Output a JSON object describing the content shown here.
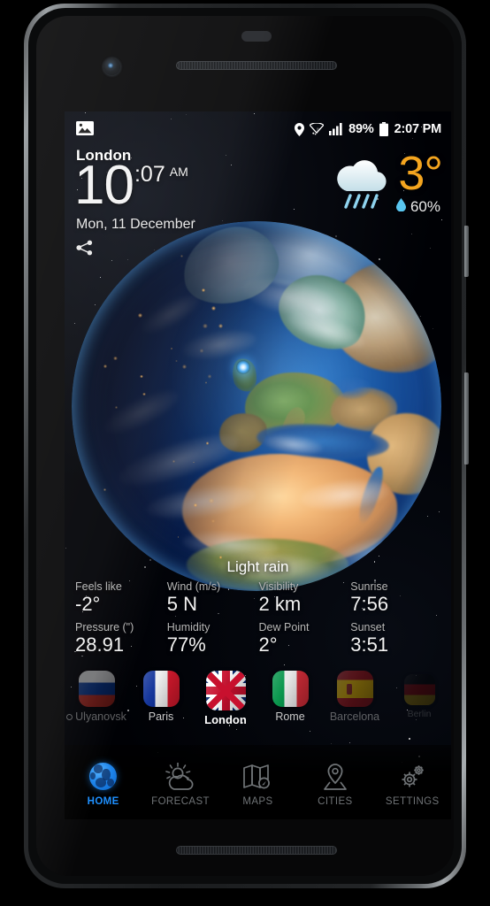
{
  "status_bar": {
    "location_icon": "location-pin-icon",
    "wifi_icon": "wifi-icon",
    "signal_icon": "cellular-signal-icon",
    "battery_percent": "89%",
    "battery_icon": "battery-icon",
    "clock": "2:07 PM"
  },
  "header": {
    "photo_icon": "image-icon",
    "city": "London",
    "time_hour": "10",
    "time_minute": ":07",
    "time_ampm": "AM",
    "date": "Mon, 11 December",
    "share_icon": "share-icon"
  },
  "current_weather": {
    "icon": "rain-cloud-icon",
    "temperature": "3",
    "degree": "°",
    "precip_icon": "water-drop-icon",
    "precip_chance": "60%",
    "condition": "Light rain",
    "temp_color": "#f4a51f",
    "accent_color": "#1e90ff"
  },
  "details": [
    {
      "label": "Feels like",
      "value": "-2°"
    },
    {
      "label": "Wind (m/s)",
      "value": "5 N"
    },
    {
      "label": "Visibility",
      "value": "2 km"
    },
    {
      "label": "Sunrise",
      "value": "7:56"
    },
    {
      "label": "Pressure (\")",
      "value": "28.91"
    },
    {
      "label": "Humidity",
      "value": "77%"
    },
    {
      "label": "Dew Point",
      "value": "2°"
    },
    {
      "label": "Sunset",
      "value": "3:51"
    }
  ],
  "cities": [
    {
      "label": "Ulyanovsk",
      "flag": "ru",
      "current_location": true
    },
    {
      "label": "Paris",
      "flag": "fr",
      "current_location": false
    },
    {
      "label": "London",
      "flag": "gb",
      "current_location": false
    },
    {
      "label": "Rome",
      "flag": "it",
      "current_location": false
    },
    {
      "label": "Barcelona",
      "flag": "es",
      "current_location": false
    },
    {
      "label": "Berlin",
      "flag": "de",
      "current_location": false
    }
  ],
  "nav": [
    {
      "label": "HOME",
      "icon": "globe-icon"
    },
    {
      "label": "FORECAST",
      "icon": "sun-cloud-icon"
    },
    {
      "label": "MAPS",
      "icon": "folded-map-icon"
    },
    {
      "label": "CITIES",
      "icon": "map-pin-icon"
    },
    {
      "label": "SETTINGS",
      "icon": "gears-icon"
    }
  ]
}
